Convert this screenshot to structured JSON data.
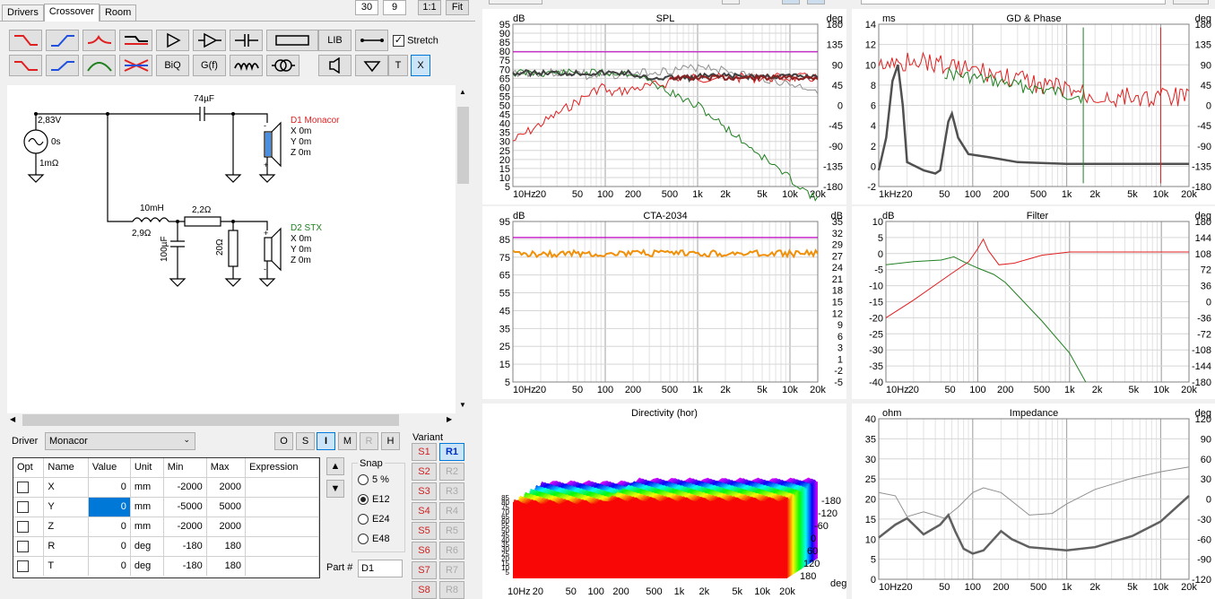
{
  "tabs": [
    "Drivers",
    "Crossover",
    "Room"
  ],
  "top_controls": {
    "num1": "30",
    "num2": "9",
    "ratio": "1:1",
    "fit": "Fit"
  },
  "toolbar": {
    "lib": "LIB",
    "stretch": "Stretch",
    "biq": "BiQ",
    "gf": "G(f)",
    "t": "T",
    "x": "X",
    "icons": [
      "highpass-1-icon",
      "highpass-2-icon",
      "peak-icon",
      "step-icon",
      "buffer-icon",
      "opamp-icon",
      "capacitor-icon",
      "resistor-icon",
      "lowpass-1-icon",
      "allpass-icon",
      "bandpass-icon",
      "notch-icon",
      "inductor-icon",
      "transformer-icon",
      "speaker-icon",
      "ground-icon",
      "wire-icon"
    ]
  },
  "schematic": {
    "source_voltage": "2,83V",
    "source_delay": "0s",
    "source_res": "1mΩ",
    "cap1": "74µF",
    "ind1": "10mH",
    "ind1_res": "2,9Ω",
    "res1": "2,2Ω",
    "cap2": "100µF",
    "res2": "20Ω",
    "d1_name": "D1 Monacor",
    "d1_x": "X 0m",
    "d1_y": "Y 0m",
    "d1_z": "Z 0m",
    "d2_name": "D2 STX",
    "d2_x": "X 0m",
    "d2_y": "Y 0m",
    "d2_z": "Z 0m",
    "d1_color": "#e02020",
    "d2_color": "#208020"
  },
  "driver": {
    "label": "Driver",
    "selected": "Monacor"
  },
  "mode_buttons": [
    "O",
    "S",
    "I",
    "M",
    "R",
    "H"
  ],
  "table": {
    "headers": [
      "Opt",
      "Name",
      "Value",
      "Unit",
      "Min",
      "Max",
      "Expression"
    ],
    "rows": [
      {
        "name": "X",
        "value": "0",
        "unit": "mm",
        "min": "-2000",
        "max": "2000"
      },
      {
        "name": "Y",
        "value": "0",
        "unit": "mm",
        "min": "-5000",
        "max": "5000"
      },
      {
        "name": "Z",
        "value": "0",
        "unit": "mm",
        "min": "-2000",
        "max": "2000"
      },
      {
        "name": "R",
        "value": "0",
        "unit": "deg",
        "min": "-180",
        "max": "180"
      },
      {
        "name": "T",
        "value": "0",
        "unit": "deg",
        "min": "-180",
        "max": "180"
      }
    ]
  },
  "snap": {
    "label": "Snap",
    "options": [
      "5 %",
      "E12",
      "E24",
      "E48"
    ],
    "selected": "E12"
  },
  "part": {
    "label": "Part #",
    "value": "D1"
  },
  "variant": {
    "label": "Variant",
    "s": [
      "S1",
      "S2",
      "S3",
      "S4",
      "S5",
      "S6",
      "S7",
      "S8"
    ],
    "r": [
      "R1",
      "R2",
      "R3",
      "R4",
      "R5",
      "R6",
      "R7",
      "R8"
    ]
  },
  "charts": {
    "spl": {
      "title": "SPL",
      "left_unit": "dB",
      "right_unit": "deg",
      "left_ticks": [
        "95",
        "90",
        "85",
        "80",
        "75",
        "70",
        "65",
        "60",
        "55",
        "50",
        "45",
        "40",
        "35",
        "30",
        "25",
        "20",
        "15",
        "10",
        "5"
      ],
      "right_ticks": [
        "180",
        "135",
        "90",
        "45",
        "0",
        "-45",
        "-90",
        "-135",
        "-180"
      ],
      "x_ticks": [
        "10Hz",
        "20",
        "50",
        "100",
        "200",
        "500",
        "1k",
        "2k",
        "5k",
        "10k",
        "20k"
      ]
    },
    "gd": {
      "title": "GD & Phase",
      "left_unit": "ms",
      "right_unit": "deg",
      "left_ticks": [
        "14",
        "12",
        "10",
        "8",
        "6",
        "4",
        "2",
        "0",
        "-2"
      ],
      "right_ticks": [
        "180",
        "135",
        "90",
        "45",
        "0",
        "-45",
        "-90",
        "-135",
        "-180"
      ],
      "x_ticks": [
        "1kHz",
        "20",
        "50",
        "100",
        "200",
        "500",
        "1k",
        "2k",
        "5k",
        "10k",
        "20k"
      ]
    },
    "cta": {
      "title": "CTA-2034",
      "left_unit": "dB",
      "right_unit": "dB",
      "left_ticks": [
        "95",
        "85",
        "75",
        "65",
        "55",
        "45",
        "35",
        "25",
        "15",
        "5"
      ],
      "right_ticks": [
        "35",
        "32",
        "29",
        "27",
        "24",
        "21",
        "18",
        "15",
        "12",
        "9",
        "6",
        "3",
        "1",
        "-2",
        "-5"
      ],
      "x_ticks": [
        "10Hz",
        "20",
        "50",
        "100",
        "200",
        "500",
        "1k",
        "2k",
        "5k",
        "10k",
        "20k"
      ]
    },
    "filter": {
      "title": "Filter",
      "left_unit": "dB",
      "right_unit": "deg",
      "left_ticks": [
        "10",
        "5",
        "0",
        "-5",
        "-10",
        "-15",
        "-20",
        "-25",
        "-30",
        "-35",
        "-40"
      ],
      "right_ticks": [
        "180",
        "144",
        "108",
        "72",
        "36",
        "0",
        "-36",
        "-72",
        "-108",
        "-144",
        "-180"
      ],
      "x_ticks": [
        "10Hz",
        "20",
        "50",
        "100",
        "200",
        "500",
        "1k",
        "2k",
        "5k",
        "10k",
        "20k"
      ]
    },
    "directivity": {
      "title": "Directivity (hor)",
      "left_ticks": [
        "85",
        "80",
        "75",
        "70",
        "65",
        "60",
        "55",
        "50",
        "45",
        "40",
        "35",
        "30",
        "25",
        "20",
        "15",
        "10",
        "5"
      ],
      "angle_ticks": [
        "-180",
        "-120",
        "-60",
        "0",
        "60",
        "120",
        "180"
      ],
      "angle_unit": "deg",
      "x_ticks": [
        "10Hz",
        "20",
        "50",
        "100",
        "200",
        "500",
        "1k",
        "2k",
        "5k",
        "10k",
        "20k"
      ]
    },
    "impedance": {
      "title": "Impedance",
      "left_unit": "ohm",
      "right_unit": "deg",
      "left_ticks": [
        "40",
        "35",
        "30",
        "25",
        "20",
        "15",
        "10",
        "5",
        "0"
      ],
      "right_ticks": [
        "120",
        "90",
        "60",
        "30",
        "0",
        "-30",
        "-60",
        "-90",
        "-120"
      ],
      "x_ticks": [
        "10Hz",
        "20",
        "50",
        "100",
        "200",
        "500",
        "1k",
        "2k",
        "5k",
        "10k",
        "20k"
      ]
    }
  }
}
